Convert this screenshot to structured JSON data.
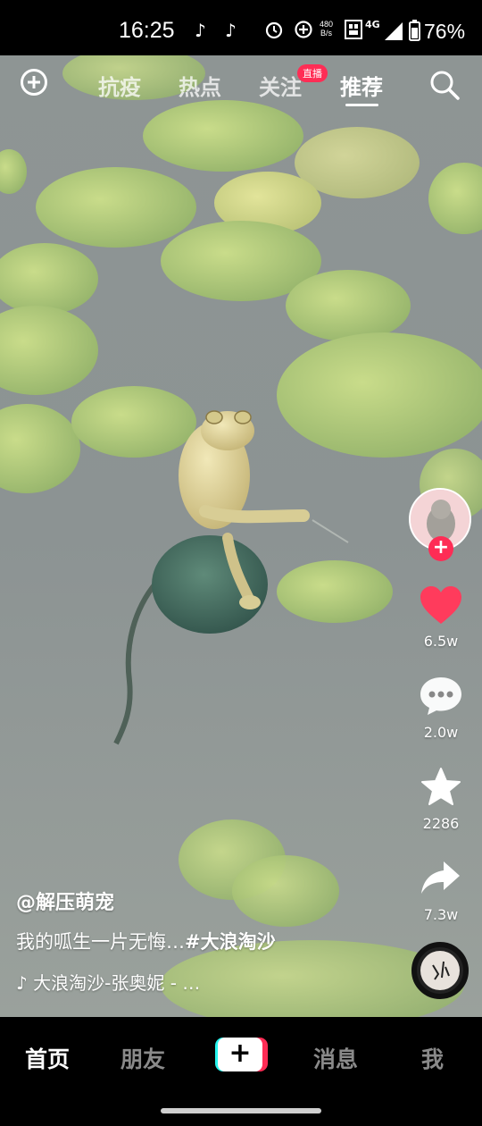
{
  "status_bar": {
    "time": "16:25",
    "net_speed_value": "480",
    "net_speed_unit": "B/s",
    "network": "4G",
    "battery": "76%"
  },
  "top_nav": {
    "tabs": [
      "抗疫",
      "热点",
      "关注",
      "推荐"
    ],
    "active_tab": "推荐",
    "live_badge": "直播"
  },
  "right_rail": {
    "likes": "6.5w",
    "comments": "2.0w",
    "favorites": "2286",
    "shares": "7.3w"
  },
  "caption": {
    "author": "@解压萌宠",
    "description": "我的呱生一片无悔…",
    "hashtag": "#大浪淘沙",
    "music": "大浪淘沙-张奥妮 - …"
  },
  "bottom_nav": {
    "home": "首页",
    "friends": "朋友",
    "create": "+",
    "messages": "消息",
    "me": "我"
  },
  "colors": {
    "accent_red": "#fe2c55",
    "accent_cyan": "#25f4ee",
    "like_red": "#ff3b5c"
  }
}
